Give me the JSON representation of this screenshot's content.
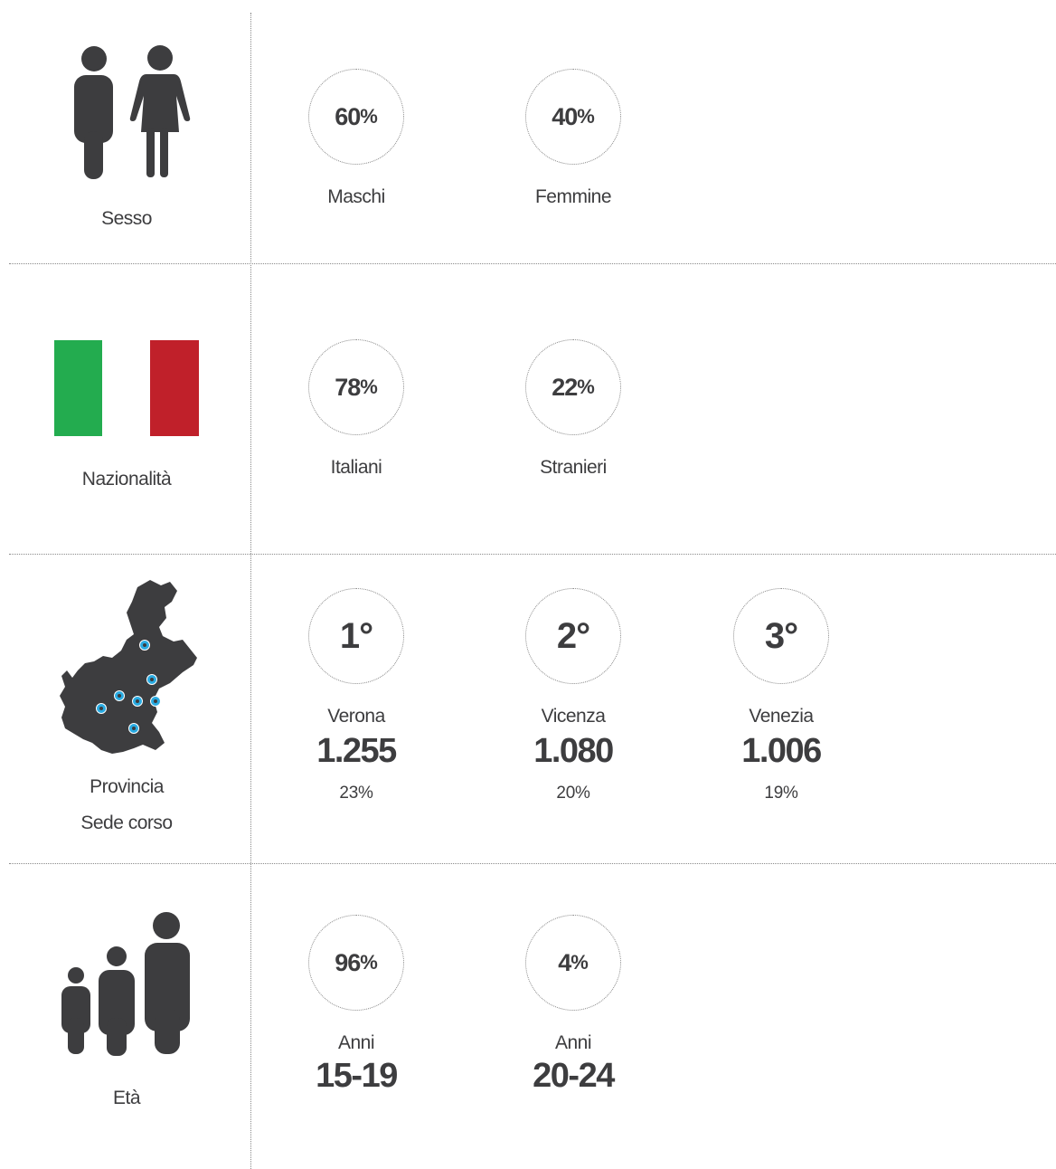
{
  "sections": {
    "sesso": {
      "label": "Sesso",
      "stats": [
        {
          "value": "60",
          "unit": "%",
          "label": "Maschi"
        },
        {
          "value": "40",
          "unit": "%",
          "label": "Femmine"
        }
      ]
    },
    "nazionalita": {
      "label": "Nazionalità",
      "flag_colors": [
        "#23ac4f",
        "#ffffff",
        "#c0202a"
      ],
      "stats": [
        {
          "value": "78",
          "unit": "%",
          "label": "Italiani"
        },
        {
          "value": "22",
          "unit": "%",
          "label": "Stranieri"
        }
      ]
    },
    "provincia": {
      "label_line1": "Provincia",
      "label_line2": "Sede corso",
      "map_color": "#3d3d3f",
      "marker_color": "#29abe2",
      "stats": [
        {
          "rank": "1°",
          "name": "Verona",
          "count": "1.255",
          "percent": "23%"
        },
        {
          "rank": "2°",
          "name": "Vicenza",
          "count": "1.080",
          "percent": "20%"
        },
        {
          "rank": "3°",
          "name": "Venezia",
          "count": "1.006",
          "percent": "19%"
        }
      ]
    },
    "eta": {
      "label": "Età",
      "stats": [
        {
          "value": "96",
          "unit": "%",
          "label": "Anni",
          "range": "15-19"
        },
        {
          "value": "4",
          "unit": "%",
          "label": "Anni",
          "range": "20-24"
        }
      ]
    }
  },
  "colors": {
    "icon": "#3d3d3f",
    "divider": "#8a8a8a"
  }
}
